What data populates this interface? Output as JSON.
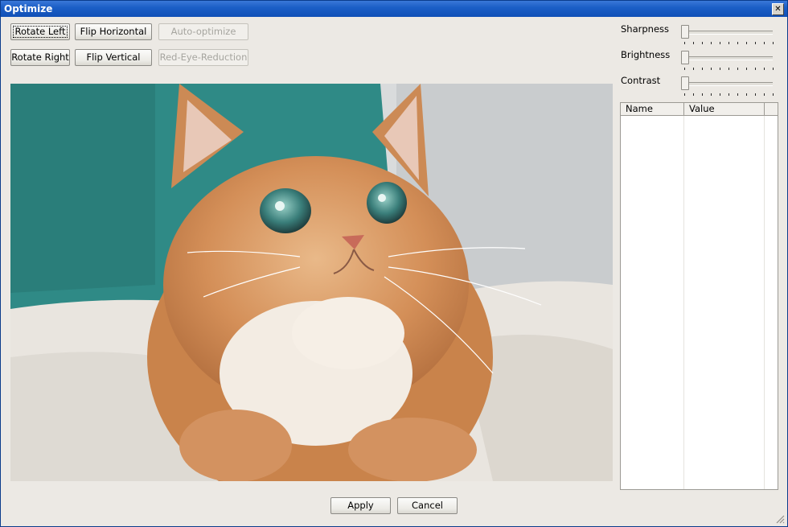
{
  "window": {
    "title": "Optimize"
  },
  "toolbar": {
    "rotate_left": "Rotate Left",
    "flip_horizontal": "Flip Horizontal",
    "auto_optimize": "Auto-optimize",
    "rotate_right": "Rotate Right",
    "flip_vertical": "Flip Vertical",
    "red_eye_reduction": "Red-Eye-Reduction"
  },
  "adjustments": [
    {
      "label": "Sharpness",
      "level": 0
    },
    {
      "label": "Brightness",
      "level": 0
    },
    {
      "label": "Contrast",
      "level": 0
    }
  ],
  "properties": {
    "columns": [
      "Name",
      "Value"
    ]
  },
  "footer": {
    "apply": "Apply",
    "cancel": "Cancel"
  },
  "colors": {
    "titlebar": "#1c5fc7",
    "background": "#ece9e4"
  }
}
